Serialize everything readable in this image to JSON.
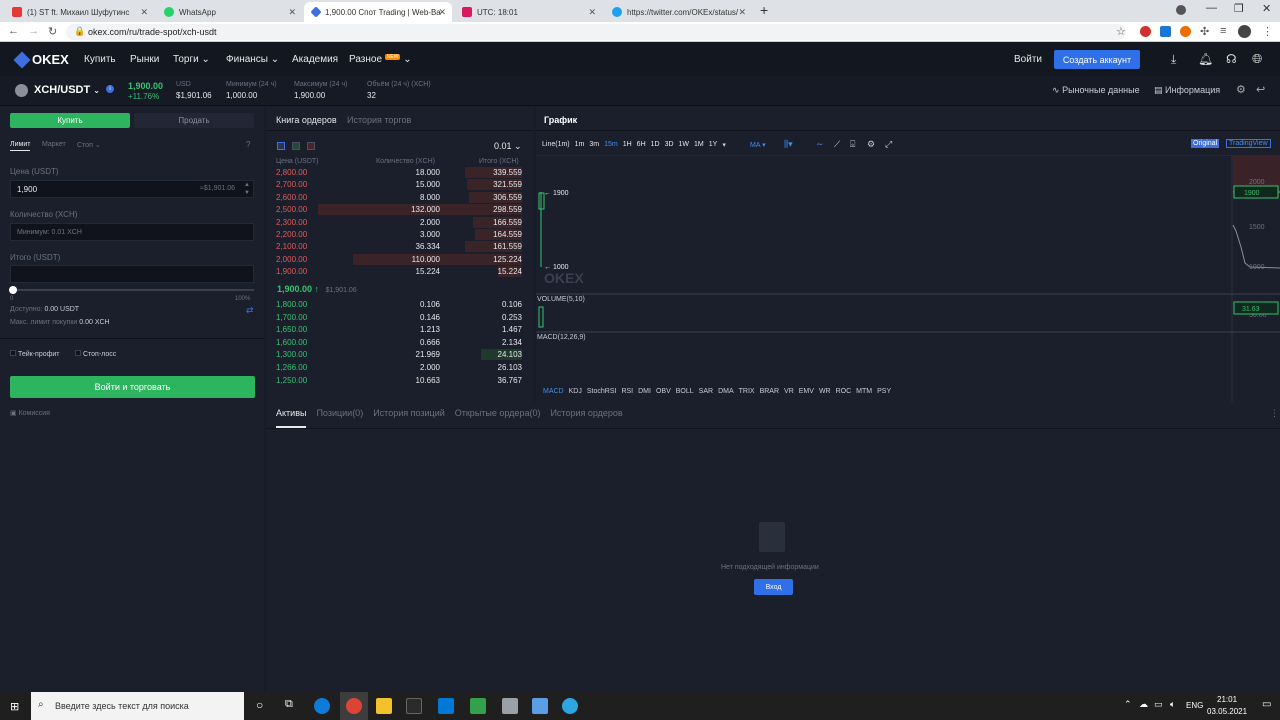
{
  "browser": {
    "tabs": [
      {
        "title": "(1) ST ft. Михаил Шуфутинс",
        "color": "#e53935"
      },
      {
        "title": "WhatsApp",
        "color": "#25d366"
      },
      {
        "title": "1,900.00 Спот Trading | Web-Ba",
        "color": "#3e6ee0"
      },
      {
        "title": "UTC: 18:01",
        "color": "#d81b60"
      },
      {
        "title": "https://twitter.com/OKEx/status/",
        "color": "#1da1f2"
      }
    ],
    "url": "okex.com/ru/trade-spot/xch-usdt",
    "new_tab": "+"
  },
  "header": {
    "logo": "OKEX",
    "nav": [
      "Купить",
      "Рынки",
      "Торги",
      "Финансы",
      "Академия",
      "Разное"
    ],
    "new_badge": "NEW",
    "login": "Войти",
    "create_account": "Создать аккаунт"
  },
  "ticker": {
    "pair": "XCH/USDT",
    "price": "1,900.00",
    "change": "+11.76%",
    "usd_label": "USD",
    "usd_value": "$1,901.06",
    "min_label": "Минимум (24 ч)",
    "min_value": "1,000.00",
    "max_label": "Максимум (24 ч)",
    "max_value": "1,900.00",
    "vol_label": "Объём (24 ч) (XCH)",
    "vol_value": "32",
    "market_data": "Рыночные данные",
    "info": "Информация"
  },
  "order_form": {
    "buy": "Купить",
    "sell": "Продать",
    "types": [
      "Лимит",
      "Маркет",
      "Стоп"
    ],
    "price_label": "Цена (USDT)",
    "price_value": "1,900",
    "price_hint": "≈$1,901.06",
    "qty_label": "Количество (XCH)",
    "qty_placeholder": "Минимум: 0.01 XCH",
    "total_label": "Итого (USDT)",
    "slider_min": "0",
    "slider_max": "100%",
    "available_label": "Доступно:",
    "available_value": "0.00 USDT",
    "max_buy_label": "Макс. лимит покупки",
    "max_buy_value": "0.00 XCH",
    "take_profit": "Тейк-профит",
    "stop_loss": "Стоп-лосс",
    "submit": "Войти и торговать",
    "commission": "Комиссия"
  },
  "orderbook": {
    "tabs": [
      "Книга ордеров",
      "История торгов"
    ],
    "precision": "0.01",
    "headers": [
      "Цена (USDT)",
      "Количество (XCH)",
      "Итого (XCH)"
    ],
    "asks": [
      {
        "price": "2,800.00",
        "qty": "18.000",
        "total": "339.559",
        "depth": 0.28
      },
      {
        "price": "2,700.00",
        "qty": "15.000",
        "total": "321.559",
        "depth": 0.27
      },
      {
        "price": "2,600.00",
        "qty": "8.000",
        "total": "306.559",
        "depth": 0.26
      },
      {
        "price": "2,500.00",
        "qty": "132.000",
        "total": "298.559",
        "depth": 1.0
      },
      {
        "price": "2,300.00",
        "qty": "2.000",
        "total": "166.559",
        "depth": 0.24
      },
      {
        "price": "2,200.00",
        "qty": "3.000",
        "total": "164.559",
        "depth": 0.23
      },
      {
        "price": "2,100.00",
        "qty": "36.334",
        "total": "161.559",
        "depth": 0.28
      },
      {
        "price": "2,000.00",
        "qty": "110.000",
        "total": "125.224",
        "depth": 0.83
      },
      {
        "price": "1,900.00",
        "qty": "15.224",
        "total": "15.224",
        "depth": 0.12
      }
    ],
    "last_price": "1,900.00 ↑",
    "last_usd": "$1,901.06",
    "bids": [
      {
        "price": "1,800.00",
        "qty": "0.106",
        "total": "0.106",
        "depth": 0.0
      },
      {
        "price": "1,700.00",
        "qty": "0.146",
        "total": "0.253",
        "depth": 0.0
      },
      {
        "price": "1,650.00",
        "qty": "1.213",
        "total": "1.467",
        "depth": 0.0
      },
      {
        "price": "1,600.00",
        "qty": "0.666",
        "total": "2.134",
        "depth": 0.0
      },
      {
        "price": "1,300.00",
        "qty": "21.969",
        "total": "24.103",
        "depth": 0.2
      },
      {
        "price": "1,266.00",
        "qty": "2.000",
        "total": "26.103",
        "depth": 0.0
      },
      {
        "price": "1,250.00",
        "qty": "10.663",
        "total": "36.767",
        "depth": 0.0
      }
    ]
  },
  "chart": {
    "title": "График",
    "intervals": [
      "Line(1m)",
      "1m",
      "3m",
      "15m",
      "1H",
      "6H",
      "1D",
      "3D",
      "1W",
      "1M",
      "1Y"
    ],
    "active_interval": "15m",
    "ma": "MA",
    "view_original": "Original",
    "view_tv": "TradingView",
    "label_1900": "1900",
    "label_1000": "1000",
    "axis": [
      "2000",
      "1500",
      "1000",
      "50.00"
    ],
    "price_tag": "1900",
    "volume_tag": "31.63",
    "volume_label": "VOLUME(5,10)",
    "macd_label": "MACD(12,26,9)",
    "watermark": "OKEX",
    "indicators": [
      "MACD",
      "KDJ",
      "StochRSI",
      "RSI",
      "DMI",
      "OBV",
      "BOLL",
      "SAR",
      "DMA",
      "TRIX",
      "BRAR",
      "VR",
      "EMV",
      "WR",
      "ROC",
      "MTM",
      "PSY"
    ]
  },
  "bottom": {
    "tabs": [
      "Активы",
      "Позиции(0)",
      "История позиций",
      "Открытые ордера(0)",
      "История ордеров"
    ],
    "empty": "Нет подходящей информации",
    "login": "Вход"
  },
  "taskbar": {
    "search": "Введите здесь текст для поиска",
    "lang": "ENG",
    "time": "21:01",
    "date": "03.05.2021"
  }
}
